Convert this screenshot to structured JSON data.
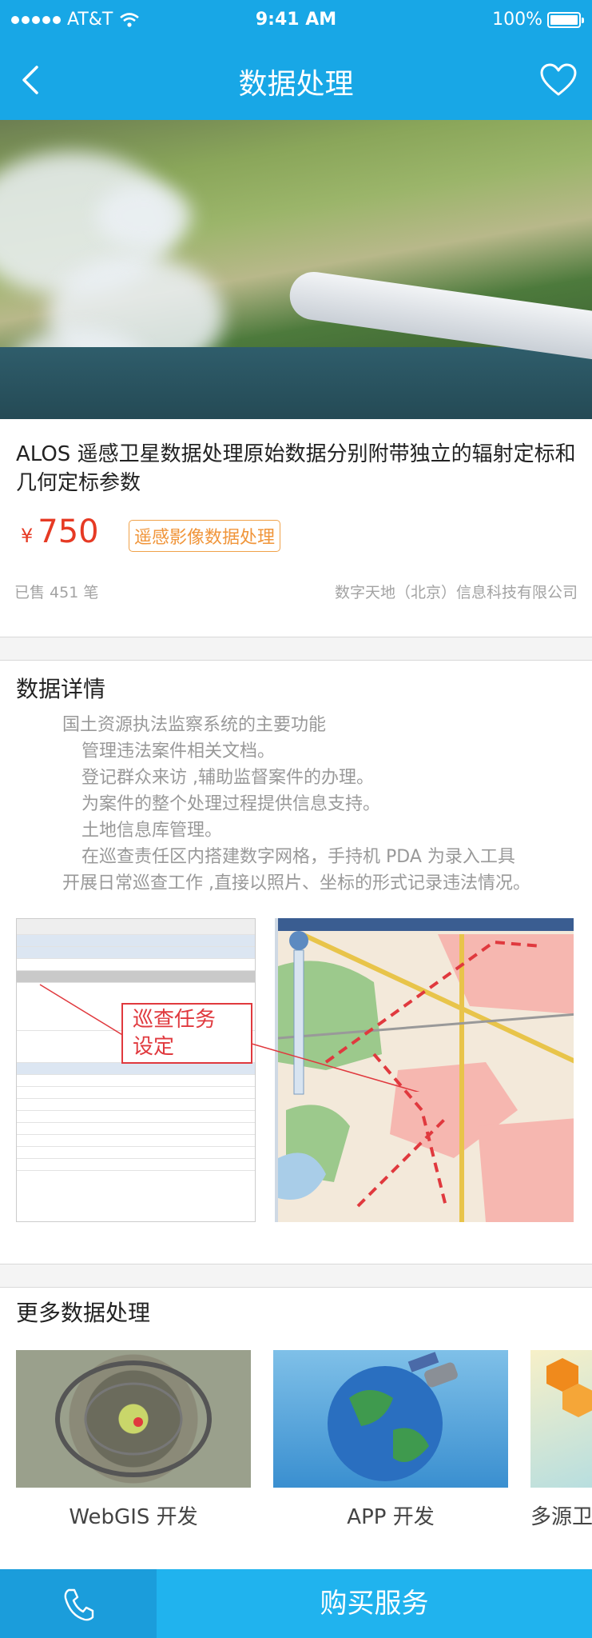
{
  "status": {
    "carrier": "AT&T",
    "time": "9:41 AM",
    "battery": "100%"
  },
  "nav": {
    "title": "数据处理",
    "back_icon": "chevron-left-icon",
    "favorite_icon": "heart-icon"
  },
  "product": {
    "title": "ALOS 遥感卫星数据处理原始数据分别附带独立的辐射定标和几何定标参数",
    "currency": "¥",
    "price": "750",
    "tag": "遥感影像数据处理",
    "sold": "已售 451 笔",
    "company": "数字天地（北京）信息科技有限公司"
  },
  "details": {
    "section_title": "数据详情",
    "lines": [
      "国土资源执法监察系统的主要功能",
      "管理违法案件相关文档。",
      "登记群众来访 ,辅助监督案件的办理。",
      "为案件的整个处理过程提供信息支持。",
      "土地信息库管理。",
      "在巡查责任区内搭建数字网格，手持机 PDA 为录入工具",
      "开展日常巡查工作 ,直接以照片、坐标的形式记录违法情况。"
    ],
    "callout": [
      "巡查任务",
      "设定"
    ]
  },
  "more": {
    "section_title": "更多数据处理",
    "items": [
      {
        "label": "WebGIS 开发"
      },
      {
        "label": "APP 开发"
      },
      {
        "label": "多源卫"
      }
    ]
  },
  "bottom": {
    "call_icon": "phone-icon",
    "buy_label": "购买服务"
  },
  "colors": {
    "primary": "#18a7e6",
    "price": "#e63a24",
    "tag": "#f0953a"
  }
}
